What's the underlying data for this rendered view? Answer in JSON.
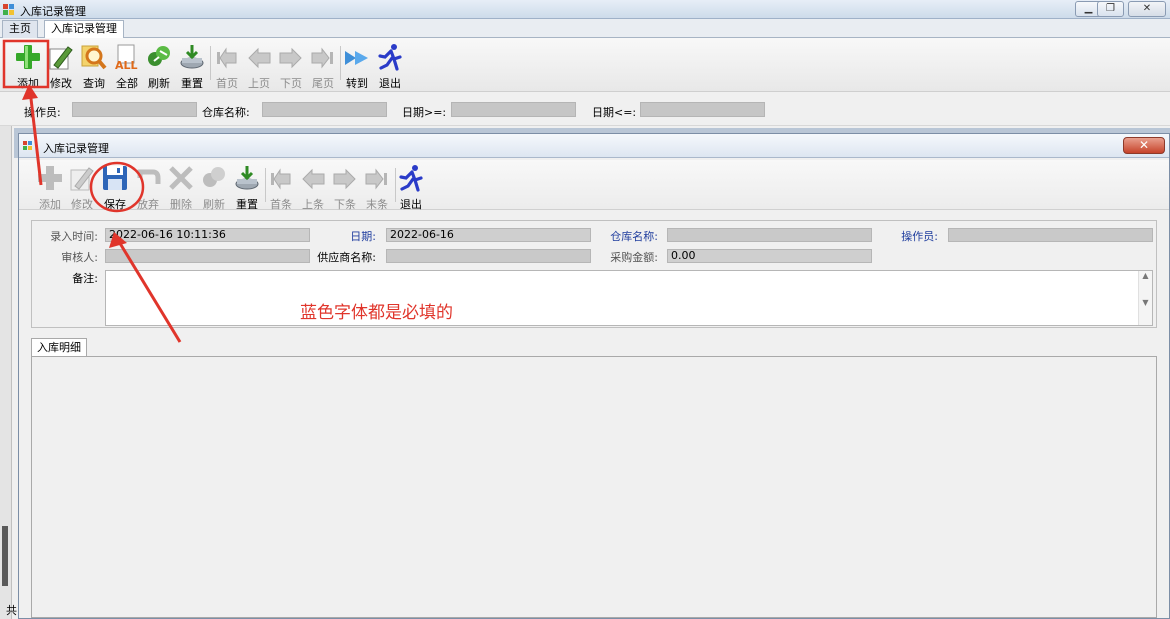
{
  "window": {
    "title": "入库记录管理",
    "buttons": [
      "▁",
      "❐",
      "✕"
    ]
  },
  "tabs": [
    "主页",
    "入库记录管理"
  ],
  "main_toolbar": [
    {
      "label": "添加",
      "icon": "plus-icon",
      "enabled": true
    },
    {
      "label": "修改",
      "icon": "edit-pencil-icon",
      "enabled": true
    },
    {
      "label": "查询",
      "icon": "search-magnifier-icon",
      "enabled": true
    },
    {
      "label": "全部",
      "icon": "all-icon",
      "enabled": true
    },
    {
      "label": "刷新",
      "icon": "refresh-icon",
      "enabled": true
    },
    {
      "label": "重置",
      "icon": "reset-icon",
      "enabled": true
    },
    {
      "label": "首页",
      "icon": "first-page-icon",
      "enabled": false
    },
    {
      "label": "上页",
      "icon": "prev-page-icon",
      "enabled": false
    },
    {
      "label": "下页",
      "icon": "next-page-icon",
      "enabled": false
    },
    {
      "label": "尾页",
      "icon": "last-page-icon",
      "enabled": false
    },
    {
      "label": "转到",
      "icon": "goto-icon",
      "enabled": true
    },
    {
      "label": "退出",
      "icon": "exit-runner-icon",
      "enabled": true
    }
  ],
  "filters": {
    "operator_label": "操作员:",
    "warehouse_label": "仓库名称:",
    "date_from_label": "日期>=:",
    "date_to_label": "日期<=:"
  },
  "left_bottom_text": "共",
  "child_window": {
    "title": "入库记录管理",
    "close": "✕",
    "toolbar": [
      {
        "label": "添加",
        "icon": "plus-icon",
        "enabled": false
      },
      {
        "label": "修改",
        "icon": "edit-icon",
        "enabled": false
      },
      {
        "label": "保存",
        "icon": "save-disk-icon",
        "enabled": true
      },
      {
        "label": "放弃",
        "icon": "undo-icon",
        "enabled": false
      },
      {
        "label": "删除",
        "icon": "delete-x-icon",
        "enabled": false
      },
      {
        "label": "刷新",
        "icon": "refresh-icon",
        "enabled": false
      },
      {
        "label": "重置",
        "icon": "reset-icon",
        "enabled": true
      },
      {
        "label": "首条",
        "icon": "first-record-icon",
        "enabled": false
      },
      {
        "label": "上条",
        "icon": "prev-record-icon",
        "enabled": false
      },
      {
        "label": "下条",
        "icon": "next-record-icon",
        "enabled": false
      },
      {
        "label": "末条",
        "icon": "last-record-icon",
        "enabled": false
      },
      {
        "label": "退出",
        "icon": "exit-runner-icon",
        "enabled": true
      }
    ],
    "form": {
      "entry_time_label": "录入时间:",
      "entry_time_value": "2022-06-16 10:11:36",
      "date_label": "日期:",
      "date_value": "2022-06-16",
      "warehouse_label": "仓库名称:",
      "operator_label": "操作员:",
      "reviewer_label": "审核人:",
      "supplier_label": "供应商名称:",
      "amount_label": "采购金额:",
      "amount_value": "0.00",
      "remark_label": "备注:"
    },
    "detail_tab": "入库明细"
  },
  "annotation": {
    "note": "蓝色字体都是必填的",
    "color": "#e0352b"
  },
  "colors": {
    "required_label": "#1f3d9e",
    "disabled_label": "#8c8c8c"
  }
}
